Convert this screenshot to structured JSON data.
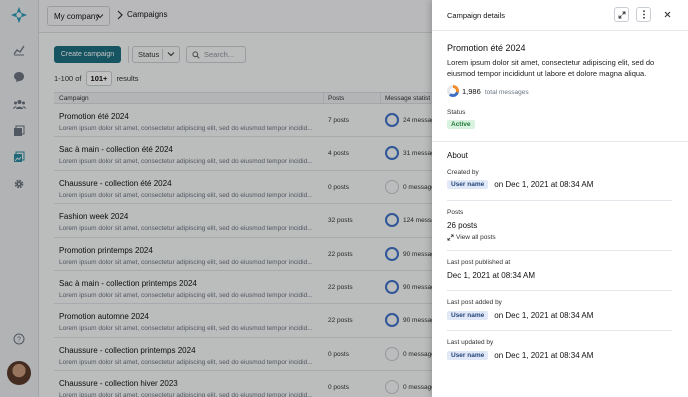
{
  "topbar": {
    "company": "My company",
    "breadcrumb": "Campaigns"
  },
  "toolbar": {
    "create_label": "Create campaign",
    "status_label": "Status",
    "search_placeholder": "Search..."
  },
  "pagination": {
    "range": "1-100 of",
    "total": "101+",
    "suffix": "results"
  },
  "table": {
    "columns": [
      "Campaign",
      "Posts",
      "Message statist"
    ],
    "rows": [
      {
        "title": "Promotion été 2024",
        "desc": "Lorem ipsum dolor sit amet, consectetur adipiscing elit, sed do eiusmod tempor incidid...",
        "posts": "7 posts",
        "messages": "24 messag",
        "ring": "filled"
      },
      {
        "title": "Sac à main - collection été 2024",
        "desc": "Lorem ipsum dolor sit amet, consectetur adipiscing elit, sed do eiusmod tempor incidid...",
        "posts": "4 posts",
        "messages": "31 messag",
        "ring": "filled"
      },
      {
        "title": "Chaussure - collection été 2024",
        "desc": "Lorem ipsum dolor sit amet, consectetur adipiscing elit, sed do eiusmod tempor incidid...",
        "posts": "0 posts",
        "messages": "0 message",
        "ring": "empty"
      },
      {
        "title": "Fashion week 2024",
        "desc": "Lorem ipsum dolor sit amet, consectetur adipiscing elit, sed do eiusmod tempor incidid...",
        "posts": "32 posts",
        "messages": "124 messa",
        "ring": "filled"
      },
      {
        "title": "Promotion printemps 2024",
        "desc": "Lorem ipsum dolor sit amet, consectetur adipiscing elit, sed do eiusmod tempor incidid...",
        "posts": "22 posts",
        "messages": "90 messag",
        "ring": "filled"
      },
      {
        "title": "Sac à main - collection printemps 2024",
        "desc": "Lorem ipsum dolor sit amet, consectetur adipiscing elit, sed do eiusmod tempor incidid...",
        "posts": "22 posts",
        "messages": "90 messag",
        "ring": "filled"
      },
      {
        "title": "Promotion automne 2024",
        "desc": "Lorem ipsum dolor sit amet, consectetur adipiscing elit, sed do eiusmod tempor incidid...",
        "posts": "22 posts",
        "messages": "90 messag",
        "ring": "filled"
      },
      {
        "title": "Chaussure - collection printemps 2024",
        "desc": "Lorem ipsum dolor sit amet, consectetur adipiscing elit, sed do eiusmod tempor incidid...",
        "posts": "0 posts",
        "messages": "0 message",
        "ring": "empty"
      },
      {
        "title": "Chaussure - collection hiver 2023",
        "desc": "Lorem ipsum dolor sit amet, consectetur adipiscing elit, sed do eiusmod tempor incidid...",
        "posts": "0 posts",
        "messages": "0 message",
        "ring": "empty"
      }
    ]
  },
  "panel": {
    "header": "Campaign details",
    "campaign_title": "Promotion été 2024",
    "description": "Lorem ipsum dolor sit amet, consectetur adipiscing elit, sed do eiusmod tempor incididunt ut labore et dolore magna aliqua.",
    "total_messages": "1,986",
    "total_label": "total messages",
    "status_label": "Status",
    "status_value": "Active",
    "about": "About",
    "created_by_label": "Created by",
    "created_by_user": "User name",
    "created_by_date": "on Dec 1, 2021 at 08:34 AM",
    "posts_label": "Posts",
    "posts_value": "26 posts",
    "view_all": "View all posts",
    "last_published_label": "Last post published at",
    "last_published_value": "Dec 1, 2021 at 08:34 AM",
    "last_added_label": "Last post added by",
    "last_added_user": "User name",
    "last_added_date": "on Dec 1, 2021 at 08:34 AM",
    "last_updated_label": "Last updated by",
    "last_updated_user": "User name",
    "last_updated_date": "on Dec 1, 2021 at 08:34 AM"
  },
  "colors": {
    "accent": "#1d6f80",
    "ring": "#3f72c5",
    "active_badge": "#d9f2df"
  }
}
